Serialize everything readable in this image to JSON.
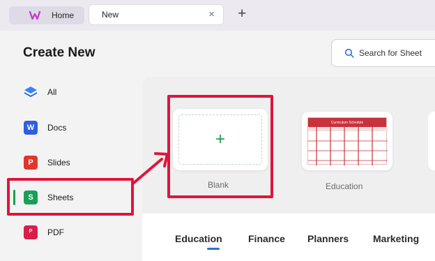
{
  "tabs": {
    "home_label": "Home",
    "new_label": "New",
    "close_glyph": "×",
    "add_glyph": "+"
  },
  "header": {
    "title": "Create New",
    "search_placeholder": "Search for Sheet"
  },
  "sidebar": {
    "items": [
      {
        "label": "All",
        "icon": "layers-icon",
        "color": "#2f6fd6"
      },
      {
        "label": "Docs",
        "icon": "docs-icon",
        "glyph": "W",
        "color": "#2f5fe0"
      },
      {
        "label": "Slides",
        "icon": "slides-icon",
        "glyph": "P",
        "color": "#e2352c"
      },
      {
        "label": "Sheets",
        "icon": "sheets-icon",
        "glyph": "S",
        "color": "#18a058"
      },
      {
        "label": "PDF",
        "icon": "pdf-icon",
        "glyph": "ᴾ",
        "color": "#d61f4c"
      }
    ]
  },
  "templates": [
    {
      "caption": "Blank",
      "glyph": "+"
    },
    {
      "caption": "Education",
      "thumb_title": "Curriculum Schedule"
    }
  ],
  "categories": [
    "Education",
    "Finance",
    "Planners",
    "Marketing"
  ],
  "colors": {
    "accent_green": "#19a04b",
    "annotation_red": "#e0143c",
    "active_tab_underline": "#2f6fd6"
  }
}
